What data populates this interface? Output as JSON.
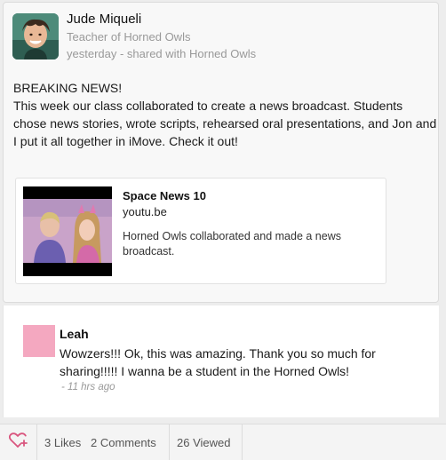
{
  "post": {
    "author": "Jude Miqueli",
    "role": "Teacher of Horned Owls",
    "meta": "yesterday - shared with Horned Owls",
    "headline": "BREAKING NEWS!",
    "body": "This week our class collaborated to create a news broadcast. Students chose news stories, wrote scripts, rehearsed oral presentations, and Jon and I put it all together in iMove. Check it out!",
    "link": {
      "title": "Space News 10",
      "domain": "youtu.be",
      "description": "Horned Owls collaborated and made a news broadcast."
    }
  },
  "comment": {
    "author": "Leah",
    "text": "Wowzers!!! Ok, this was amazing. Thank you so much for sharing!!!!! I wanna be a student in the Horned Owls!",
    "time": "- 11 hrs ago"
  },
  "actions": {
    "likes": "3 Likes",
    "comments": "2 Comments",
    "viewed": "26 Viewed"
  },
  "colors": {
    "like_icon": "#d9567f",
    "comment_avatar": "#f4a8c0"
  },
  "icons": {
    "like": "heart-plus-icon"
  }
}
